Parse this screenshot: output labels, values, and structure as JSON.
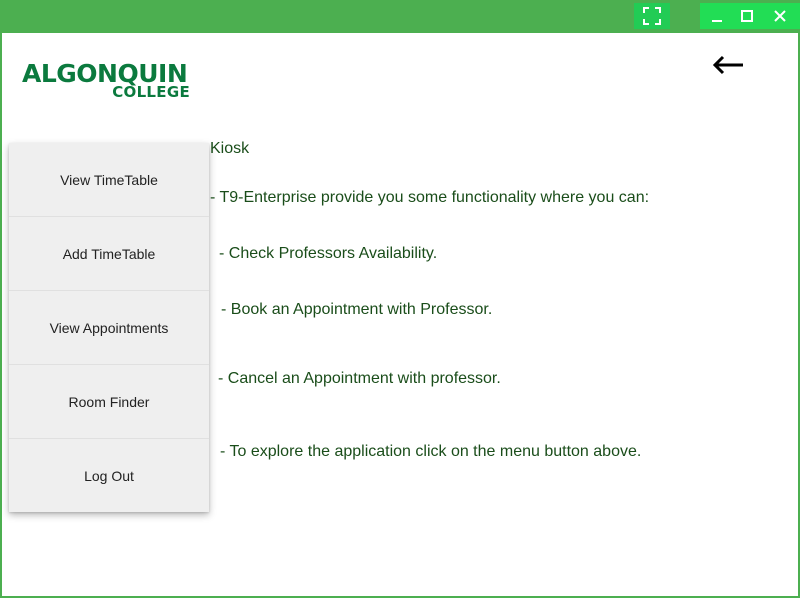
{
  "window": {
    "controls": {
      "fullscreen_icon": "fullscreen-icon",
      "minimize_icon": "minimize-icon",
      "maximize_icon": "maximize-icon",
      "close_icon": "close-icon"
    },
    "accent_color": "#4caf50"
  },
  "logo": {
    "line1": "ALGONQUIN",
    "line2": "COLLEGE",
    "color": "#0b7a3e"
  },
  "header": {
    "back_icon": "arrow-left-icon"
  },
  "menu": {
    "items": [
      {
        "label": "View TimeTable"
      },
      {
        "label": "Add TimeTable"
      },
      {
        "label": "View Appointments"
      },
      {
        "label": "Room Finder"
      },
      {
        "label": "Log Out"
      }
    ]
  },
  "content": {
    "title": "Kiosk",
    "intro": "- T9-Enterprise provide you some functionality where you can:",
    "features": [
      "- Check Professors Availability.",
      "- Book an Appointment with Professor.",
      "- Cancel an Appointment with professor.",
      "- To explore the application click on the menu button above."
    ],
    "text_color": "#1a4d1a"
  }
}
